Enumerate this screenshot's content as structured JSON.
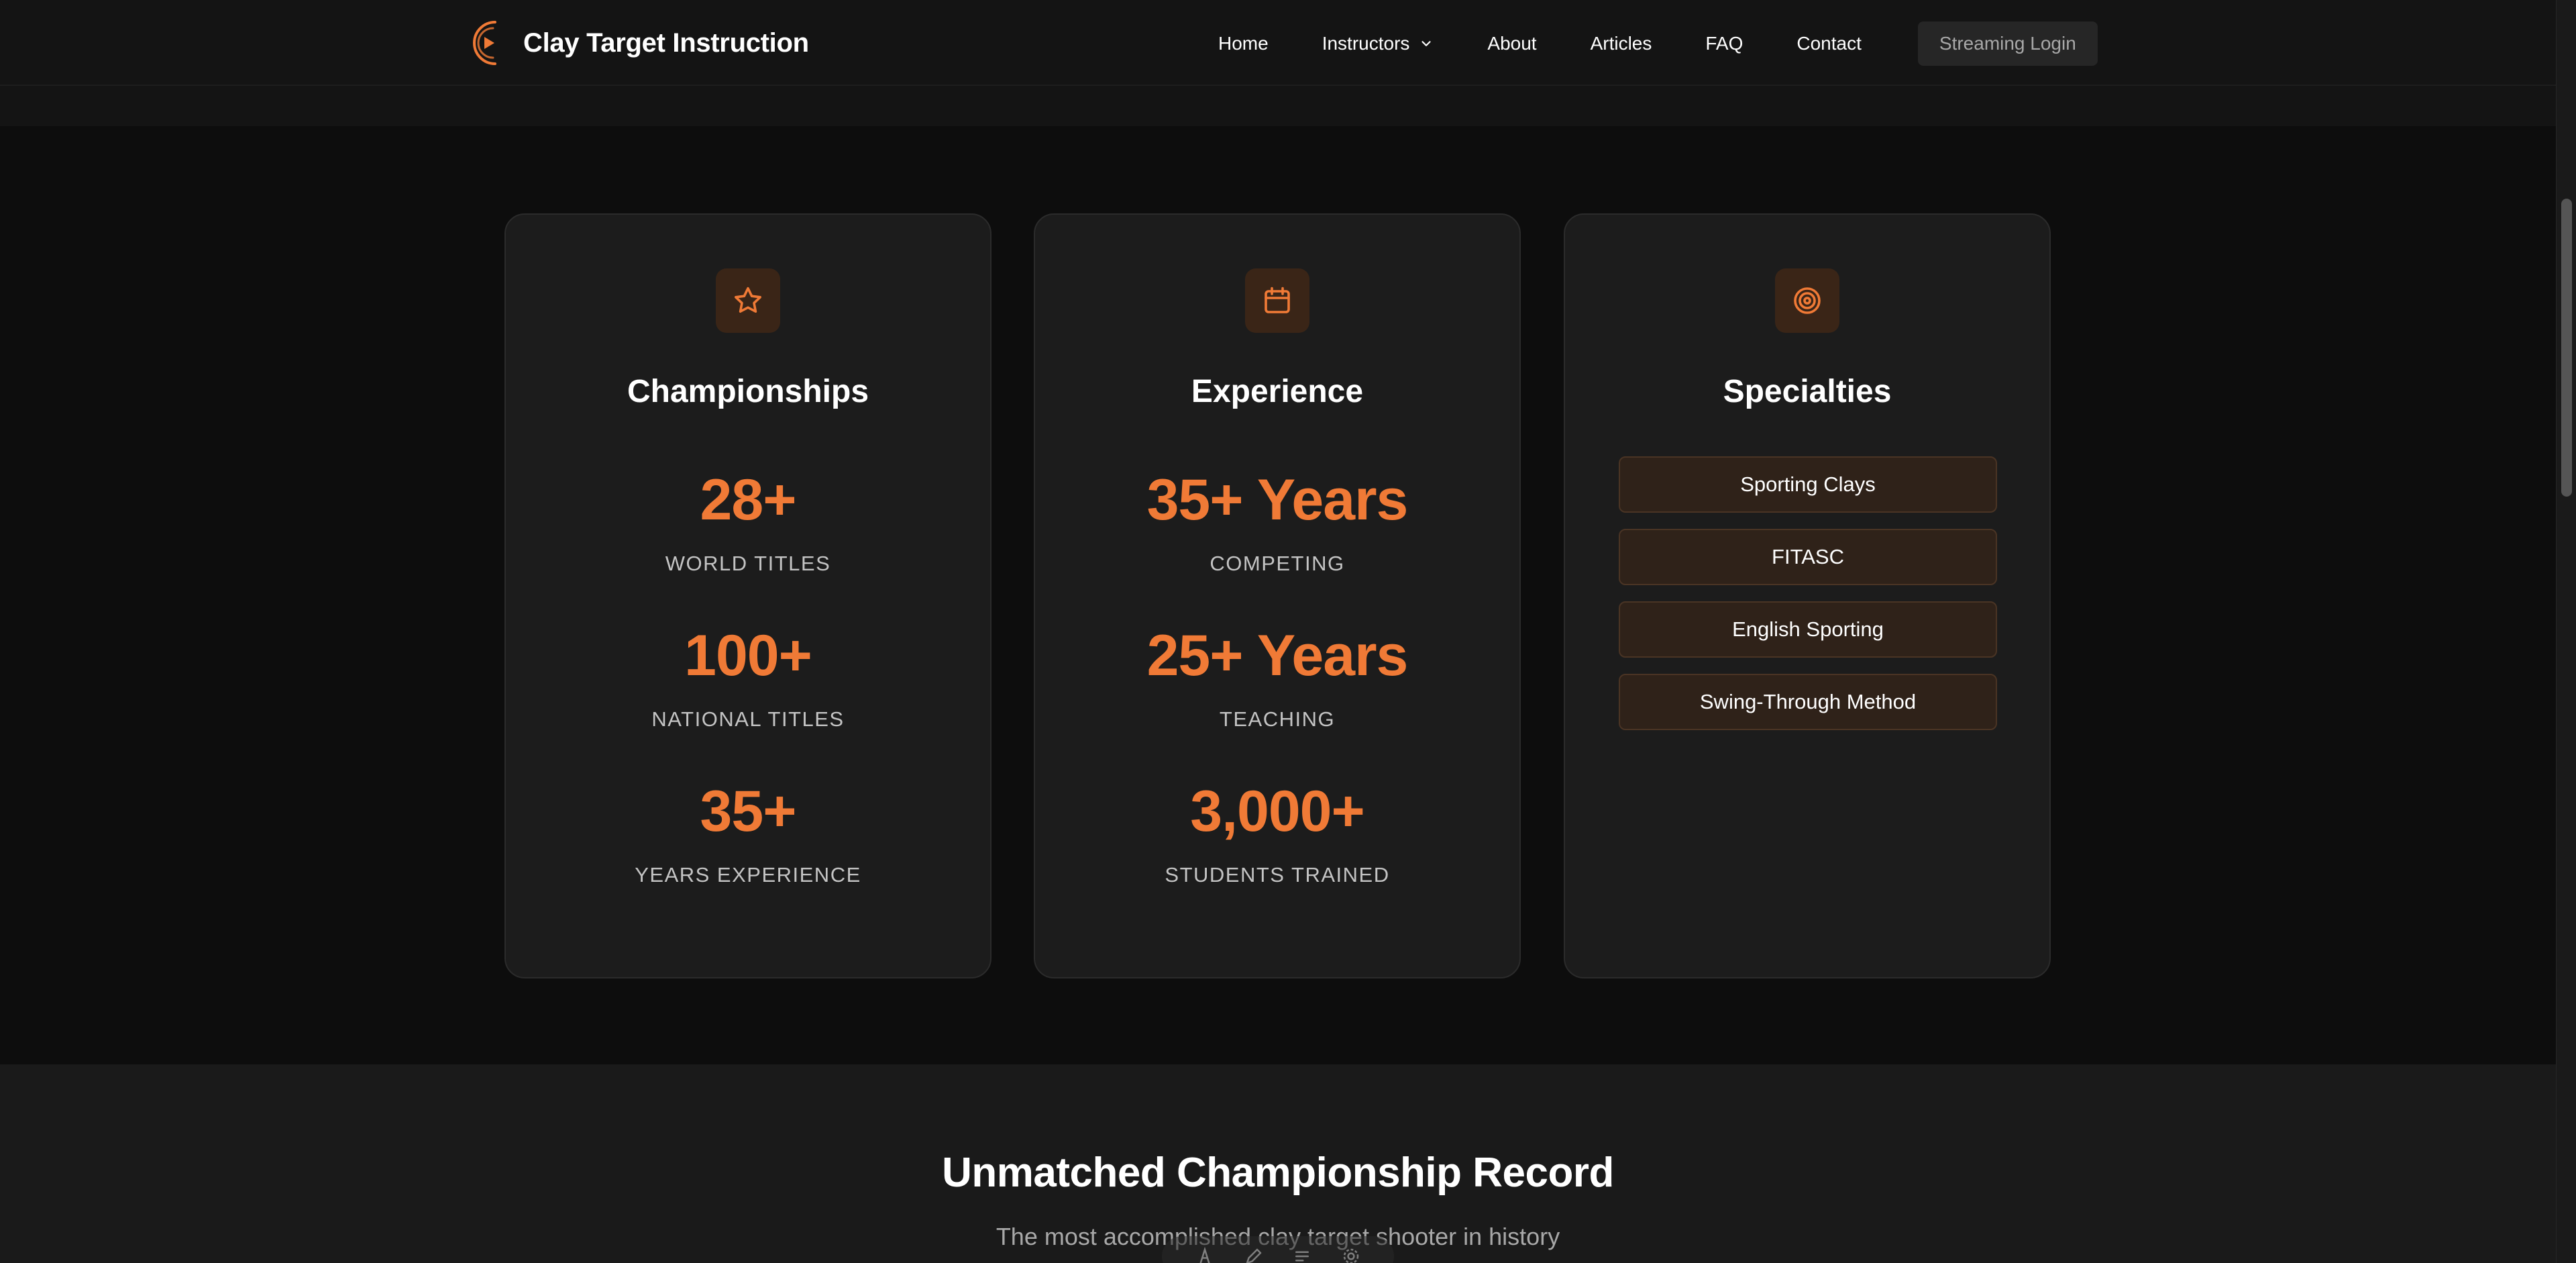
{
  "header": {
    "brand": "Clay Target Instruction",
    "nav": [
      "Home",
      "Instructors",
      "About",
      "Articles",
      "FAQ",
      "Contact"
    ],
    "cta": "Streaming Login"
  },
  "cards": {
    "championships": {
      "title": "Championships",
      "icon": "star-icon",
      "stats": [
        {
          "value": "28+",
          "label": "WORLD TITLES"
        },
        {
          "value": "100+",
          "label": "NATIONAL TITLES"
        },
        {
          "value": "35+",
          "label": "YEARS EXPERIENCE"
        }
      ]
    },
    "experience": {
      "title": "Experience",
      "icon": "calendar-icon",
      "stats": [
        {
          "value": "35+ Years",
          "label": "COMPETING"
        },
        {
          "value": "25+ Years",
          "label": "TEACHING"
        },
        {
          "value": "3,000+",
          "label": "STUDENTS TRAINED"
        }
      ]
    },
    "specialties": {
      "title": "Specialties",
      "icon": "target-icon",
      "tags": [
        "Sporting Clays",
        "FITASC",
        "English Sporting",
        "Swing-Through Method"
      ]
    }
  },
  "record": {
    "title": "Unmatched Championship Record",
    "subtitle": "The most accomplished clay target shooter in history"
  },
  "colors": {
    "accent": "#f07a36",
    "background": "#0d0d0d",
    "card": "#1c1c1c",
    "tag_background": "#2f2219"
  }
}
